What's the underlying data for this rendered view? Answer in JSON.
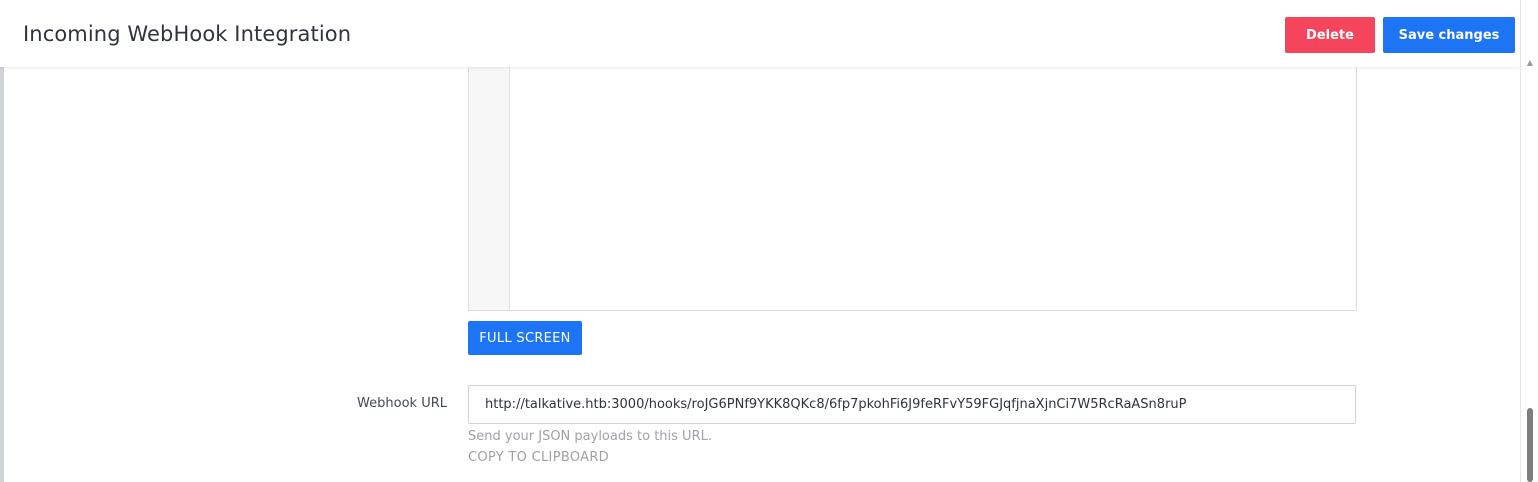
{
  "header": {
    "title": "Incoming WebHook Integration",
    "delete_label": "Delete",
    "save_label": "Save changes"
  },
  "editor": {
    "fullscreen_label": "FULL SCREEN"
  },
  "webhook": {
    "label": "Webhook URL",
    "value": "http://talkative.htb:3000/hooks/roJG6PNf9YKK8QKc8/6fp7pkohFi6J9feRFvY59FGJqfjnaXjnCi7W5RcRaASn8ruP",
    "help": "Send your JSON payloads to this URL.",
    "copy_label": "COPY TO CLIPBOARD"
  },
  "colors": {
    "delete": "#f5455c",
    "primary": "#1d74f5"
  }
}
